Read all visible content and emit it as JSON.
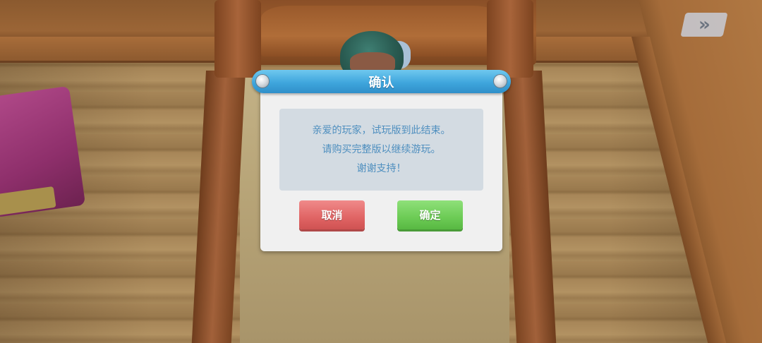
{
  "dialog": {
    "title": "确认",
    "message_lines": [
      "亲爱的玩家，试玩版到此结束。",
      "请购买完整版以继续游玩。",
      "谢谢支持！"
    ],
    "cancel_label": "取消",
    "confirm_label": "确定"
  },
  "skip_button": {
    "icon": "fast-forward-icon",
    "glyph": "»"
  },
  "colors": {
    "header_blue": "#3fa6dd",
    "message_text": "#4f8fbf",
    "cancel_red": "#e06464",
    "confirm_green": "#6ccb55"
  }
}
